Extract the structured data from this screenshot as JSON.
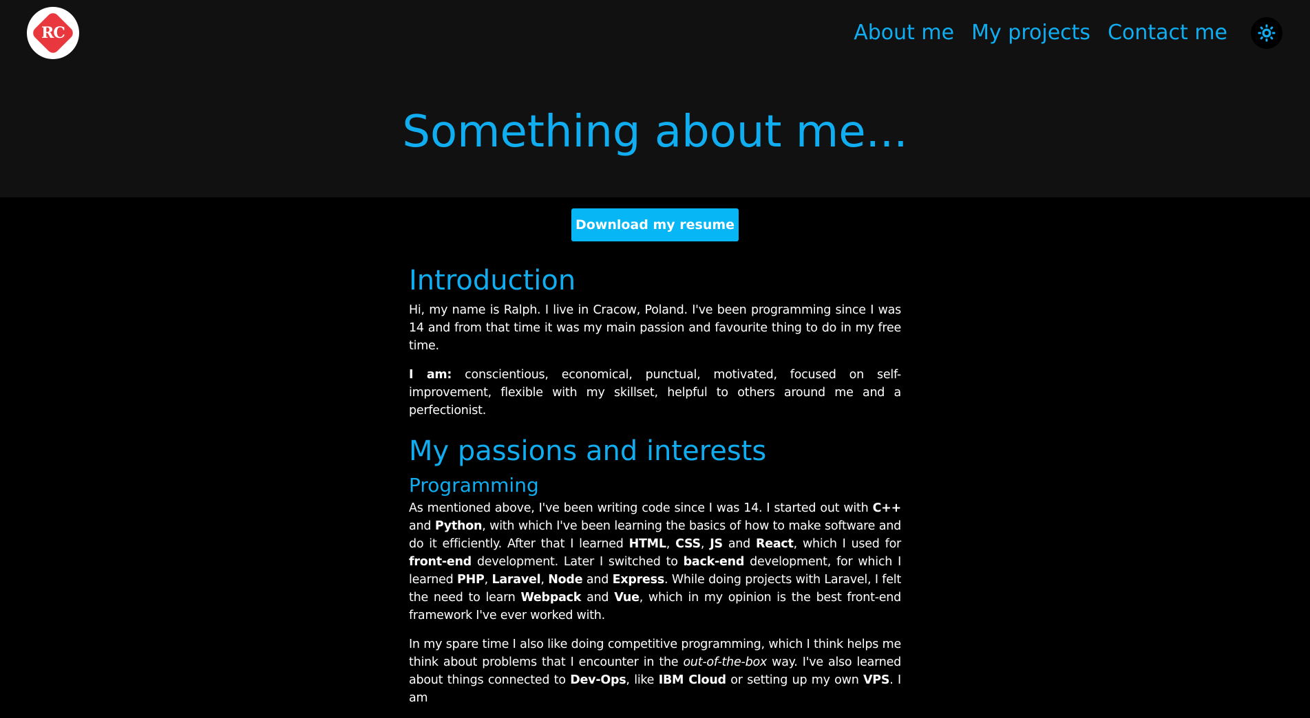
{
  "header": {
    "logo_text": "RC",
    "nav": [
      "About me",
      "My projects",
      "Contact me"
    ],
    "theme_icon": "sun-icon",
    "title": "Something about me..."
  },
  "download_button": "Download my resume",
  "intro": {
    "heading": "Introduction",
    "p1": "Hi, my name is Ralph. I live in Cracow, Poland. I've been programming since I was 14 and from that time it was my main passion and favourite thing to do in my free time.",
    "p2_label": "I am:",
    "p2_text": " conscientious, economical, punctual, motivated, focused on self-improvement, flexible with my skillset, helpful to others around me and a perfectionist."
  },
  "passions": {
    "heading": "My passions and interests",
    "subheading": "Programming",
    "p1": [
      {
        "t": "As mentioned above, I've been writing code since I was 14. I started out with "
      },
      {
        "t": "C++",
        "b": true
      },
      {
        "t": " and "
      },
      {
        "t": "Python",
        "b": true
      },
      {
        "t": ", with which I've been learning the basics of how to make software and do it efficiently. After that I learned "
      },
      {
        "t": "HTML",
        "b": true
      },
      {
        "t": ", "
      },
      {
        "t": "CSS",
        "b": true
      },
      {
        "t": ", "
      },
      {
        "t": "JS",
        "b": true
      },
      {
        "t": " and "
      },
      {
        "t": "React",
        "b": true
      },
      {
        "t": ", which I used for "
      },
      {
        "t": "front-end",
        "b": true
      },
      {
        "t": " development. Later I switched to "
      },
      {
        "t": "back-end",
        "b": true
      },
      {
        "t": " development, for which I learned "
      },
      {
        "t": "PHP",
        "b": true
      },
      {
        "t": ", "
      },
      {
        "t": "Laravel",
        "b": true
      },
      {
        "t": ", "
      },
      {
        "t": "Node",
        "b": true
      },
      {
        "t": " and "
      },
      {
        "t": "Express",
        "b": true
      },
      {
        "t": ". While doing projects with Laravel, I felt the need to learn "
      },
      {
        "t": "Webpack",
        "b": true
      },
      {
        "t": " and "
      },
      {
        "t": "Vue",
        "b": true
      },
      {
        "t": ", which in my opinion is the best front-end framework I've ever worked with."
      }
    ],
    "p2": [
      {
        "t": "In my spare time I also like doing competitive programming, which I think helps me think about problems that I encounter in the "
      },
      {
        "t": "out-of-the-box",
        "i": true
      },
      {
        "t": " way. I've also learned about things connected to "
      },
      {
        "t": "Dev-Ops",
        "b": true
      },
      {
        "t": ", like "
      },
      {
        "t": "IBM Cloud",
        "b": true
      },
      {
        "t": " or setting up my own "
      },
      {
        "t": "VPS",
        "b": true
      },
      {
        "t": ". I am"
      }
    ]
  },
  "colors": {
    "accent": "#10aef0",
    "button": "#06b6f5",
    "header_bg": "#111111",
    "page_bg": "#000000",
    "logo_red": "#e8373d"
  }
}
